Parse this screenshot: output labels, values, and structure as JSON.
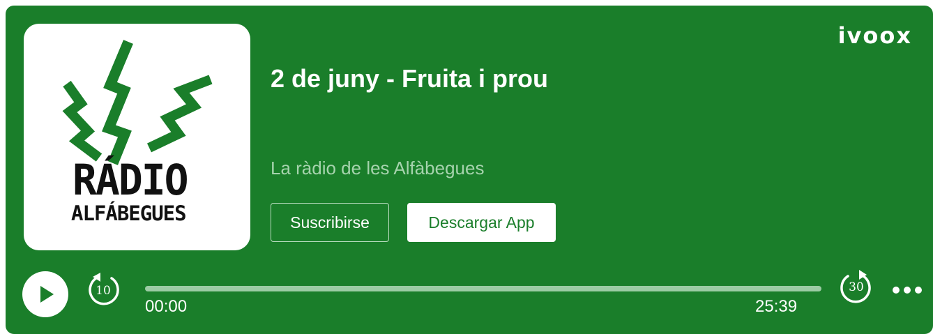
{
  "episode": {
    "title": "2 de juny - Fruita i prou",
    "show_name": "La ràdio de les Alfàbegues"
  },
  "cover": {
    "line1": "RÁDIO",
    "line2": "ALFÁBEGUES"
  },
  "brand": {
    "name": "ivoox"
  },
  "buttons": {
    "subscribe_label": "Suscribirse",
    "download_app_label": "Descargar App"
  },
  "player": {
    "current_time": "00:00",
    "total_time": "25:39",
    "progress_fraction": 0,
    "skip_back_seconds": "10",
    "skip_forward_seconds": "30"
  },
  "icons": {
    "play": "play-icon",
    "skip_back": "rewind-10-icon",
    "skip_forward": "forward-30-icon",
    "more": "more-options-icon"
  },
  "colors": {
    "background": "#1a7e2a",
    "accent_text": "#a6d3ad",
    "progress_track": "#9ccca4"
  }
}
